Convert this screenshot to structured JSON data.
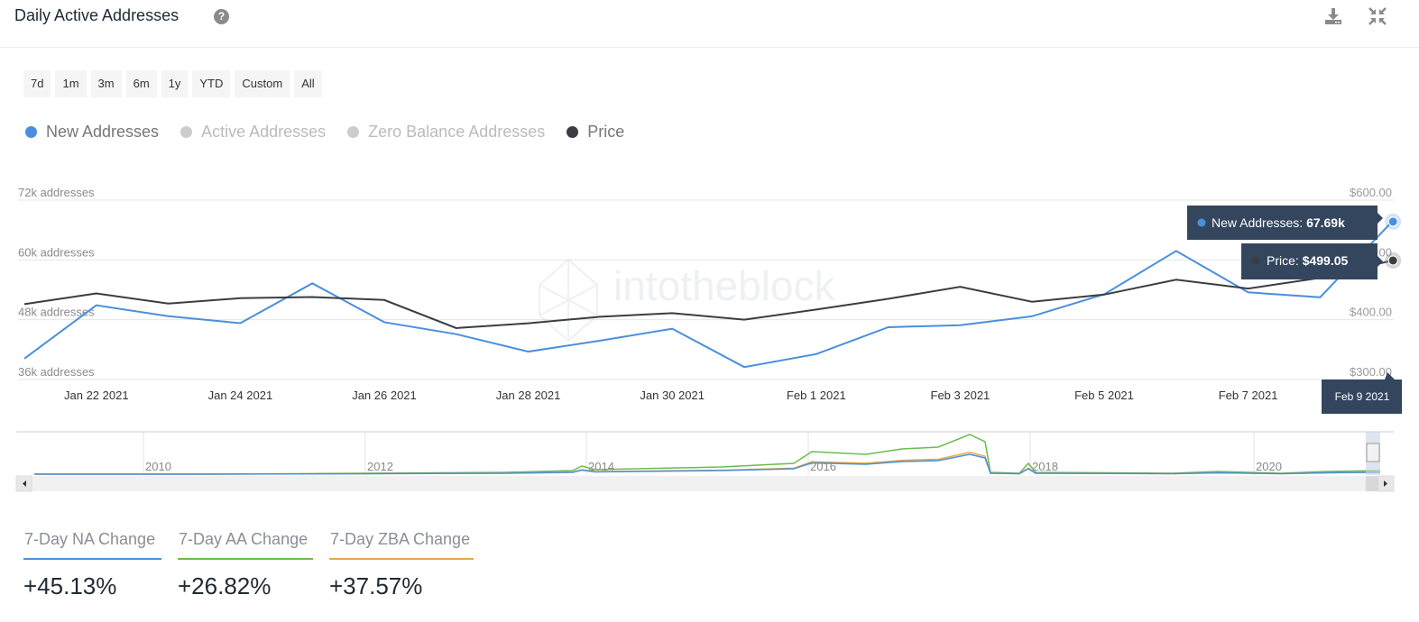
{
  "header": {
    "title": "Daily Active Addresses",
    "help_icon": "question-circle-icon",
    "download_icon": "download-icon",
    "collapse_icon": "compress-arrows-icon"
  },
  "range_buttons": [
    "7d",
    "1m",
    "3m",
    "6m",
    "1y",
    "YTD",
    "Custom",
    "All"
  ],
  "legend": [
    {
      "label": "New Addresses",
      "color": "#4a8fdd",
      "active": true
    },
    {
      "label": "Active Addresses",
      "color": "#cccccc",
      "active": false
    },
    {
      "label": "Zero Balance Addresses",
      "color": "#cccccc",
      "active": false
    },
    {
      "label": "Price",
      "color": "#3a3d42",
      "active": true
    }
  ],
  "chart_data": {
    "type": "line",
    "watermark": "intotheblock",
    "x": [
      "Jan 21 2021",
      "Jan 22 2021",
      "Jan 23 2021",
      "Jan 24 2021",
      "Jan 25 2021",
      "Jan 26 2021",
      "Jan 27 2021",
      "Jan 28 2021",
      "Jan 29 2021",
      "Jan 30 2021",
      "Jan 31 2021",
      "Feb 1 2021",
      "Feb 2 2021",
      "Feb 3 2021",
      "Feb 4 2021",
      "Feb 5 2021",
      "Feb 6 2021",
      "Feb 7 2021",
      "Feb 8 2021",
      "Feb 9 2021"
    ],
    "x_tick_labels": [
      "Jan 22 2021",
      "Jan 24 2021",
      "Jan 26 2021",
      "Jan 28 2021",
      "Jan 30 2021",
      "Feb 1 2021",
      "Feb 3 2021",
      "Feb 5 2021",
      "Feb 7 2021"
    ],
    "y_left": {
      "tick_labels": [
        "72k addresses",
        "60k addresses",
        "48k addresses",
        "36k addresses"
      ],
      "ticks": [
        72000,
        60000,
        48000,
        36000
      ],
      "range": [
        36000,
        72000
      ]
    },
    "y_right": {
      "tick_labels": [
        "$600.00",
        "$500.00",
        "$400.00",
        "$300.00"
      ],
      "ticks": [
        600,
        500,
        400,
        300
      ],
      "range": [
        300,
        600
      ]
    },
    "grid": true,
    "legend_position": "top-left",
    "series": [
      {
        "name": "New Addresses",
        "axis": "left",
        "color": "#4a8fdd",
        "values": [
          40200,
          50900,
          48700,
          47300,
          55300,
          47500,
          45100,
          41600,
          43800,
          46200,
          38500,
          41100,
          46500,
          46900,
          48700,
          53100,
          61800,
          53500,
          52500,
          67690
        ]
      },
      {
        "name": "Price",
        "axis": "right",
        "color": "#3a3d42",
        "values": [
          426,
          444,
          427,
          436,
          438,
          433,
          386,
          394,
          405,
          411,
          400,
          417,
          435,
          455,
          430,
          442,
          467,
          452,
          470,
          499.05
        ]
      }
    ],
    "tooltip": {
      "date": "Feb 9 2021",
      "rows": [
        {
          "label": "New Addresses: ",
          "value": "67.69k",
          "color": "#4a8fdd"
        },
        {
          "label": "Price: ",
          "value": "$499.05",
          "color": "#3a3d42"
        }
      ]
    },
    "navigator": {
      "year_labels": [
        "2010",
        "2012",
        "2014",
        "2016",
        "2018",
        "2020"
      ],
      "series_colors": [
        "#6dbb4f",
        "#e8a84a",
        "#4a8fdd"
      ]
    }
  },
  "stats": [
    {
      "label": "7-Day NA Change",
      "value": "+45.13%",
      "color": "#4a8fdd"
    },
    {
      "label": "7-Day AA Change",
      "value": "+26.82%",
      "color": "#6dbb4f"
    },
    {
      "label": "7-Day ZBA Change",
      "value": "+37.57%",
      "color": "#e8a84a"
    }
  ]
}
